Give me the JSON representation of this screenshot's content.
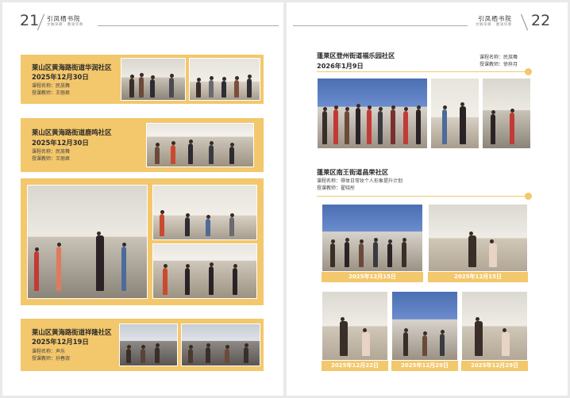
{
  "left_page": {
    "number": "21",
    "brand_title": "引凤栖书院",
    "brand_subtitle": "文脉深耕 · 墨润华章",
    "cards": [
      {
        "title": "莱山区黄海路街道华润社区",
        "date": "2025年12月30日",
        "course": "课程名称：民族舞",
        "teacher": "授课教师：王丽君"
      },
      {
        "title": "莱山区黄海路街道鹿鸣社区",
        "date": "2025年12月30日",
        "course": "课程名称：民族舞",
        "teacher": "授课教师：王丽君"
      },
      {
        "title": "莱山区黄海路街道祥隆社区",
        "date": "2025年12月19日",
        "course": "课程名称：声乐",
        "teacher": "授课教师：孙春淑"
      }
    ]
  },
  "right_page": {
    "number": "22",
    "brand_title": "引凤栖书院",
    "brand_subtitle": "文脉深耕 · 墨润华章",
    "section1": {
      "title": "蓬莱区登州街道福乐园社区",
      "date": "2026年1月9日",
      "course": "课程名称：民族舞",
      "teacher": "授课教师：徐梓月"
    },
    "section2": {
      "title": "蓬莱区南王街道昌荣社区",
      "course": "课程名称：得体日常妆个人形象提升计划",
      "teacher": "授课教师：翟晓彤",
      "photo_dates": [
        "2025年12月15日",
        "2025年12月15日",
        "2025年12月22日",
        "2025年12月29日",
        "2025年12月29日"
      ]
    }
  }
}
